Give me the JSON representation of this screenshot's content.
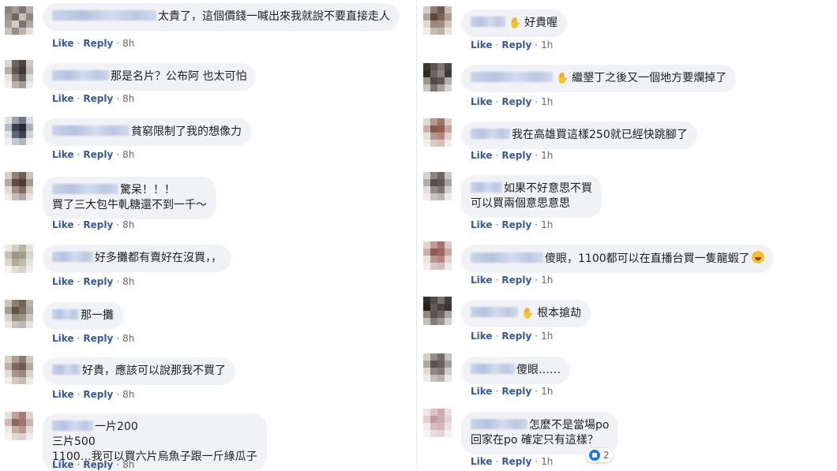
{
  "actions": {
    "like": "Like",
    "reply": "Reply",
    "separator": "·"
  },
  "left": [
    {
      "avatar": [
        "#8a8480",
        "#a39a94",
        "#7d7570",
        "#b6afa9",
        "#9b928c",
        "#6f6762",
        "#c5bfba",
        "#8e8680",
        "#a8a09a",
        "#d2cdc9",
        "#7a726d",
        "#b0a8a2",
        "#c8c2bd",
        "#958d87",
        "#bdb6b0",
        "#e2dfdc"
      ],
      "name_w": 132,
      "lines": [
        "太貴了，這個價錢一喊出來我就說不要直接走人"
      ],
      "time": "8h"
    },
    {
      "avatar": [
        "#d9d6d3",
        "#6d6560",
        "#4a4440",
        "#cbc7c4",
        "#b4aeaa",
        "#5c5550",
        "#3f3a37",
        "#c1bcb8",
        "#e8e6e4",
        "#8a837e",
        "#605954",
        "#dcd9d6",
        "#f2f1f0",
        "#b9b3ae",
        "#a29b96",
        "#ecebe9"
      ],
      "name_w": 72,
      "lines": [
        "那是名片？公布阿 也太可怕"
      ],
      "time": "8h"
    },
    {
      "avatar": [
        "#e4e2e0",
        "#9aa1ad",
        "#6f7787",
        "#d8dadf",
        "#b5bac4",
        "#3c4152",
        "#252a3a",
        "#a8aebb",
        "#dfe1e5",
        "#5d6474",
        "#3d4455",
        "#cfd2d8",
        "#f0f0f1",
        "#c3c7cf",
        "#b0b5bf",
        "#eeeff1"
      ],
      "name_w": 98,
      "lines": [
        "貧窮限制了我的想像力"
      ],
      "time": "8h"
    },
    {
      "avatar": [
        "#d6cfca",
        "#8f7f76",
        "#6e5d53",
        "#cbc2bb",
        "#b7a8a0",
        "#5a4a41",
        "#4b3c34",
        "#a89890",
        "#e1dcd8",
        "#9d8e86",
        "#7c6c63",
        "#d4ccc6",
        "#efecea",
        "#c6bdb6",
        "#b4a79f",
        "#e9e5e2"
      ],
      "name_w": 84,
      "lines": [
        "驚呆！！！",
        "買了三大包牛軋糖還不到一千～"
      ],
      "time": "8h"
    },
    {
      "avatar": [
        "#eceae6",
        "#d3cfc5",
        "#b9b3a4",
        "#e5e2dc",
        "#c8c2b4",
        "#9e977f",
        "#a49d88",
        "#d9d5cb",
        "#dcd8cf",
        "#b1aa96",
        "#c2bcab",
        "#e7e4de",
        "#f3f2ef",
        "#e0ddd5",
        "#d6d2c8",
        "#f1f0ed"
      ],
      "name_w": 52,
      "lines": [
        "好多攤都有賣好在沒買，，"
      ],
      "time": "8h"
    },
    {
      "avatar": [
        "#c8c3bd",
        "#8c7f70",
        "#6f6455",
        "#bab4ac",
        "#a59b8f",
        "#5e5448",
        "#7a6f62",
        "#b0a79c",
        "#d6d2cd",
        "#948a7d",
        "#9f9588",
        "#ccc7c1",
        "#ebe9e6",
        "#c9c4be",
        "#bfb9b1",
        "#e6e4e1"
      ],
      "name_w": 34,
      "lines": [
        "那一攤"
      ],
      "time": "8h"
    },
    {
      "avatar": [
        "#d8d2cd",
        "#b09d91",
        "#8f7a6c",
        "#cec6c0",
        "#c0b1a7",
        "#7d685b",
        "#6e5a4e",
        "#b8a89e",
        "#e2ddd9",
        "#a6958a",
        "#9a887c",
        "#d9d2cc",
        "#f0eeec",
        "#d2cac4",
        "#c7bdb6",
        "#ebe8e5"
      ],
      "name_w": 36,
      "lines": [
        "好貴，應該可以說那我不買了"
      ],
      "time": "8h"
    },
    {
      "avatar": [
        "#e6e2df",
        "#c49e98",
        "#a57c76",
        "#dcd6d2",
        "#d2b7b2",
        "#8e6661",
        "#9c7670",
        "#cdb3ae",
        "#ece9e7",
        "#c8aaa5",
        "#b8958f",
        "#e1dad7",
        "#f4f3f2",
        "#e0d8d5",
        "#dbd1cd",
        "#f0eeed"
      ],
      "name_w": 52,
      "lines": [
        "一片200",
        "三片500",
        "1100…我可以買六片烏魚子跟一斤綠瓜子"
      ],
      "time": "8h"
    }
  ],
  "right": [
    {
      "avatar": [
        "#d5cdc6",
        "#8f7a6c",
        "#6e5a4d",
        "#c8bdb4",
        "#b5a597",
        "#5d4a3e",
        "#7a6556",
        "#ad9b8d",
        "#e0dbd6",
        "#9c8879",
        "#a18d7f",
        "#d1c7bf",
        "#efece9",
        "#c7bcb3",
        "#bcafa4",
        "#e8e4e0"
      ],
      "name_w": 44,
      "wave": true,
      "lines": [
        "好貴喔"
      ],
      "time": "1h"
    },
    {
      "avatar": [
        "#3a3634",
        "#5a5552",
        "#7c7673",
        "#4a4643",
        "#2d2a28",
        "#6b6562",
        "#8d8784",
        "#3f3b39",
        "#9a9491",
        "#4f4a47",
        "#5f5956",
        "#b3aeab",
        "#c9c5c3",
        "#7a7471",
        "#a7a19e",
        "#d7d4d2"
      ],
      "name_w": 104,
      "wave": true,
      "lines": [
        "繼墾丁之後又一個地方要爛掉了"
      ],
      "time": "1h"
    },
    {
      "avatar": [
        "#e1d7d3",
        "#b99488",
        "#9c7467",
        "#d9ccc6",
        "#cbb0a6",
        "#84584b",
        "#905f50",
        "#c4a59a",
        "#e9e3e0",
        "#b8988d",
        "#ad8b7f",
        "#ddd1cb",
        "#f3f0ee",
        "#d9cbc4",
        "#d2c1b9",
        "#efebe8"
      ],
      "name_w": 50,
      "lines": [
        "我在高雄買這樣250就已經快跳腳了"
      ],
      "time": "1h"
    },
    {
      "avatar": [
        "#d6d2d0",
        "#8c8582",
        "#6c6562",
        "#cbc6c4",
        "#b3adaa",
        "#544e4b",
        "#5f5855",
        "#a8a29f",
        "#e2dfde",
        "#928b88",
        "#7c7572",
        "#d3cfcd",
        "#f0efee",
        "#c7c2c0",
        "#bbb5b2",
        "#ebe9e8"
      ],
      "name_w": 40,
      "lines": [
        "如果不好意思不買",
        "可以買兩個意思意思"
      ],
      "time": "1h"
    },
    {
      "avatar": [
        "#e2d3d1",
        "#c49a95",
        "#a8746e",
        "#dcc8c5",
        "#cfaea9",
        "#8f5a54",
        "#9a6660",
        "#c9a49f",
        "#ebe2e1",
        "#bd9690",
        "#b38781",
        "#e0d0cd",
        "#f4efee",
        "#dbc9c6",
        "#d4beba",
        "#efe8e7"
      ],
      "name_w": 92,
      "lines": [
        "傻眼，1100都可以在直播台買一隻龍蝦了"
      ],
      "emoji_end": true,
      "time": "1h"
    },
    {
      "avatar": [
        "#2f2b2a",
        "#524c4a",
        "#76706d",
        "#433e3c",
        "#24201f",
        "#625c59",
        "#4a4442",
        "#3b3634",
        "#8e8885",
        "#5a5451",
        "#6d6764",
        "#aaa5a2",
        "#c3bfbd",
        "#857f7c",
        "#9c9693",
        "#d4d1cf"
      ],
      "name_w": 60,
      "wave": true,
      "lines": [
        "根本搶劫"
      ],
      "time": "1h"
    },
    {
      "avatar": [
        "#d3cfcd",
        "#958b87",
        "#776c68",
        "#c7c2bf",
        "#b0a8a4",
        "#5e534f",
        "#6b605b",
        "#a69e9a",
        "#dfdcda",
        "#8f8581",
        "#837975",
        "#d1ccca",
        "#efeeed",
        "#c5bfbc",
        "#b8b1ad",
        "#e9e7e6"
      ],
      "name_w": 56,
      "lines": [
        "傻眼……"
      ],
      "time": "1h"
    },
    {
      "avatar": [
        "#eee4e6",
        "#dcc1c6",
        "#cfa7ae",
        "#e9dde0",
        "#e2ccd0",
        "#c39aa2",
        "#ccaab0",
        "#e3d2d5",
        "#f3ecee",
        "#d9bcc1",
        "#d4b5ba",
        "#ece2e4",
        "#f8f5f6",
        "#e8dcdf",
        "#e4d6d9",
        "#f5f1f2"
      ],
      "name_w": 72,
      "lines": [
        "怎麼不是當場po",
        "回家在po 確定只有這樣？"
      ],
      "time": "1h",
      "reaction_count": "2"
    }
  ]
}
